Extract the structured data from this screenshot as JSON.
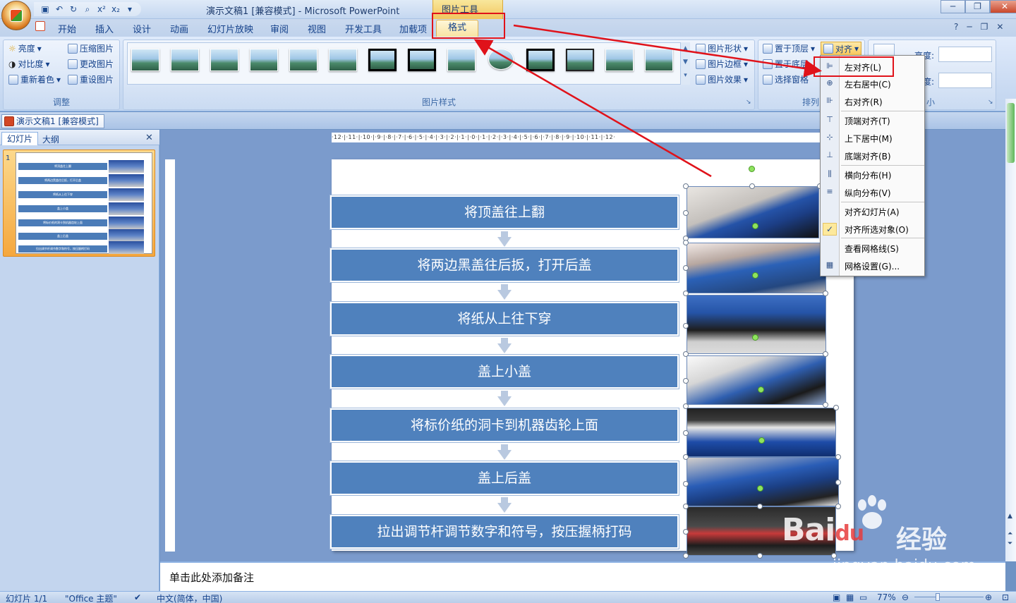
{
  "window": {
    "title": "演示文稿1 [兼容模式] - Microsoft PowerPoint",
    "context_tool": "图片工具"
  },
  "quick_access": [
    "save-icon",
    "undo-icon",
    "redo-icon",
    "print-preview-icon",
    "superscript-icon",
    "subscript-icon",
    "customize-icon"
  ],
  "qat_labels": {
    "sup": "x²",
    "sub": "x₂"
  },
  "tabs": [
    "开始",
    "插入",
    "设计",
    "动画",
    "幻灯片放映",
    "审阅",
    "视图",
    "开发工具",
    "加载项",
    "格式"
  ],
  "active_tab": "格式",
  "ribbon": {
    "adjust": {
      "label": "调整",
      "brightness": "亮度",
      "contrast": "对比度",
      "recolor": "重新着色",
      "compress": "压缩图片",
      "change": "更改图片",
      "reset": "重设图片"
    },
    "styles": {
      "label": "图片样式",
      "shape": "图片形状",
      "border": "图片边框",
      "effects": "图片效果"
    },
    "arrange": {
      "label": "排列",
      "front": "置于顶层",
      "back": "置于底层",
      "pane": "选择窗格",
      "align": "对齐"
    },
    "size": {
      "label": "小",
      "height": "高度:",
      "width": "宽度:"
    }
  },
  "doc_tab": "演示文稿1 [兼容模式]",
  "pane": {
    "slides_tab": "幻灯片",
    "outline_tab": "大纲",
    "slide_number": "1"
  },
  "ruler_h": "·12·|·11·|·10·|·9·|·8·|·7·|·6·|·5·|·4·|·3·|·2·|·1·|·0·|·1·|·2·|·3·|·4·|·5·|·6·|·7·|·8·|·9·|·10·|·11·|·12·",
  "steps": [
    "将顶盖往上翻",
    "将两边黑盖往后扳，打开后盖",
    "将纸从上往下穿",
    "盖上小盖",
    "将标价纸的洞卡到机器齿轮上面",
    "盖上后盖",
    "拉出调节杆调节数字和符号，按压握柄打码"
  ],
  "align_menu": [
    {
      "label": "左对齐(L)",
      "icon": "align-left-icon"
    },
    {
      "label": "左右居中(C)",
      "icon": "align-center-icon"
    },
    {
      "label": "右对齐(R)",
      "icon": "align-right-icon"
    },
    {
      "label": "顶端对齐(T)",
      "icon": "align-top-icon"
    },
    {
      "label": "上下居中(M)",
      "icon": "align-middle-icon"
    },
    {
      "label": "底端对齐(B)",
      "icon": "align-bottom-icon"
    },
    {
      "label": "横向分布(H)",
      "icon": "distribute-horizontal-icon"
    },
    {
      "label": "纵向分布(V)",
      "icon": "distribute-vertical-icon"
    },
    {
      "label": "对齐幻灯片(A)",
      "icon": ""
    },
    {
      "label": "对齐所选对象(O)",
      "icon": "checkmark-icon",
      "checked": true
    },
    {
      "label": "查看网格线(S)",
      "icon": ""
    },
    {
      "label": "网格设置(G)...",
      "icon": "grid-icon"
    }
  ],
  "notes_placeholder": "单击此处添加备注",
  "status": {
    "slide": "幻灯片 1/1",
    "theme": "\"Office 主题\"",
    "language": "中文(简体，中国)",
    "zoom": "77%"
  },
  "watermark": {
    "brand": "Bai",
    "brand2": "du",
    "cn": "经验",
    "url": "jingyan.baidu.com"
  },
  "colors": {
    "step_fill": "#4f81bd",
    "highlight": "#e0121a",
    "ribbon": "#c9daf2"
  }
}
